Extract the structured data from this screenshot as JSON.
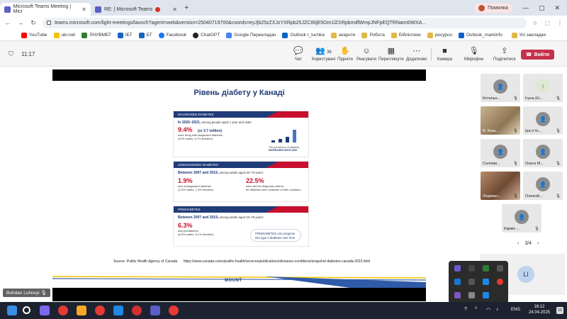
{
  "browser": {
    "tabs": [
      {
        "title": "Microsoft Teams Meeting | Micr",
        "active": true
      },
      {
        "title": "RE: | Microsoft Teams",
        "active": false
      }
    ],
    "profile_label": "Помилка",
    "url": "teams.microsoft.com/light-meetings/launch?agent=web&version=25040719700&coords=eyJjb25zZXJzYXRpb25JZCI6IjE5Om1lZXRpbmdfWmpJNFpEQTRNamt0WXA...",
    "bookmarks": [
      "YouTube",
      "ukr.net",
      "ЛНУВМБТ",
      "IБТ",
      "БТ",
      "Facebook",
      "ChatGPT",
      "Google Перекладач",
      "Outlook I_luchka",
      "акаунти",
      "Робота",
      "Бібліотеки",
      "ресурси",
      "Outlook_markinfo"
    ],
    "all_bookmarks": "Усі закладки"
  },
  "teams": {
    "timer": "11:17",
    "controls": [
      {
        "label": "Чат",
        "icon": "chat-icon"
      },
      {
        "label": "Користувачі",
        "icon": "people-icon",
        "count": "36"
      },
      {
        "label": "Підняти",
        "icon": "hand-icon"
      },
      {
        "label": "Реагувати",
        "icon": "react-icon"
      },
      {
        "label": "Переглянути",
        "icon": "view-icon"
      },
      {
        "label": "Додатково",
        "icon": "more-icon"
      },
      {
        "label": "Камера",
        "icon": "camera-icon"
      },
      {
        "label": "Мікрофон",
        "icon": "mic-icon"
      },
      {
        "label": "Поділитися",
        "icon": "share-icon"
      }
    ],
    "leave_label": "Вийти",
    "presenter": "Bohdan Luhovyi",
    "pager": "3/4"
  },
  "slide": {
    "title": "Рівень діабету у Канаді",
    "panel1": {
      "header": "DIAGNOSED DIABETES",
      "lead_bold": "In 2020–2021,",
      "lead_rest": " among people aged 1 year and older:",
      "big": "9.4%",
      "big_rest": " (or 3.7 million)",
      "sub1": "were living with diagnosed diabetes",
      "sub2": "(10% males, 8.7% females)",
      "chart_caption_1": "The prevalence of diabetes",
      "chart_caption_2": "INCREASED WITH AGE"
    },
    "panel2": {
      "header": "UNDIAGNOSED DIABETES",
      "lead_bold": "Between 2007 and 2019,",
      "lead_rest": " among adults aged 20–79 years:",
      "left_big": "1.9%",
      "left_sub1": "had undiagnosed diabetes",
      "left_sub2": "(2.5% males, 1.3% females)",
      "right_big": "22.5%",
      "right_sub1": "who met the diagnosis criteria",
      "right_sub2": "for diabetes were unaware of their condition"
    },
    "panel3": {
      "header": "PREDIABETES",
      "lead_bold": "Between 2007 and 2019,",
      "lead_rest": " among adults aged 20–79 years:",
      "big": "6.3%",
      "sub1": "had prediabetes",
      "sub2": "(6.5% males, 6.1% females)",
      "pill1": "PREDIABETES can progress",
      "pill2": "into type 2 diabetes over time"
    },
    "source_label": "Source: Public Health Agency of Canada",
    "source_url": "https://www.canada.ca/en/public-health/services/publications/diseases-conditions/snapshot-diabetes-canada-2023.html",
    "logo": "MOUNT"
  },
  "gallery": [
    {
      "name": "Котельо...",
      "type": "avatar"
    },
    {
      "name": "Iгуна (Н...",
      "type": "avatar-green"
    },
    {
      "name": "В. Кхаз...",
      "type": "photo1"
    },
    {
      "name": "Ipa (гте...",
      "type": "avatar"
    },
    {
      "name": "Соломи...",
      "type": "avatar"
    },
    {
      "name": "Ольга М...",
      "type": "avatar"
    },
    {
      "name": "Людмил...",
      "type": "photo2"
    },
    {
      "name": "Олексій...",
      "type": "avatar"
    },
    {
      "name": "Карвік ...",
      "type": "avatar"
    }
  ],
  "self_initials": "LI",
  "taskbar": {
    "lang": "ENG",
    "time": "16:12",
    "date": "24.04.2025",
    "notif": "10"
  }
}
